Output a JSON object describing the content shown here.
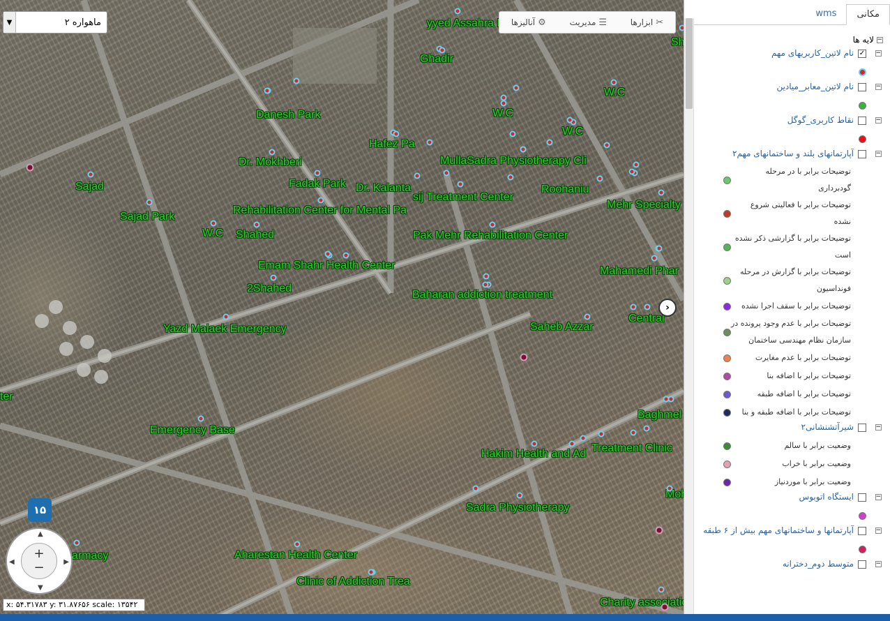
{
  "map": {
    "basemap_selector": {
      "value": "ماهواره ۲"
    },
    "toolbar": {
      "tools_label": "ابزارها",
      "manage_label": "مدیریت",
      "analysis_label": "آنالیزها"
    },
    "zoom_level": "۱۵",
    "zoom_in_label": "+",
    "zoom_out_label": "−",
    "coordinates": "x: ۵۴.۳۱۷۸۳ y: ۳۱.۸۷۶۵۶ scale: ۱۳۵۴۲",
    "collapse_label": "›",
    "poi_labels": [
      "yyed Assahra Pa",
      "Ghadir",
      "Danesh Park",
      "W.C",
      "W.C",
      "W.C",
      "Hafez Pa",
      "MullaSadra Physiotherapy Cli",
      "Dr. Mokhberi",
      "Fadak Park",
      "Dr. Kalanta",
      "Sajad",
      "sij Treatment Center",
      "Roohaniu",
      "Mehr Specialty",
      "Sajad Park",
      "Rehabilitation Center for Mental Pa",
      "W.C",
      "Shahed",
      "Pak Mehr Rehabilitation Center",
      "Emam Shahr Health Center",
      "Mahamedi Phar",
      "2Shahed",
      "Baharan addiction treatment",
      "Central",
      "Yazd Malaek Emergency",
      "Saheb Azzar",
      "ter",
      "Baghmel",
      "Emergency Base",
      "Treatment Clinic",
      "Hakim Health and Ad",
      "Sadra Physiotherapy",
      "Mohammad P",
      "h Pharmacy",
      "Aharestan Health Center",
      "Clinic of Addiction Trea",
      "Charity association for Protecti",
      "Shohadaa health c"
    ]
  },
  "panel": {
    "tabs": {
      "active": "مکانی",
      "inactive": "wms"
    },
    "tree_root": "لایه ها",
    "layers": [
      {
        "name": "نام لاتین_کاربریهای مهم",
        "checked": true,
        "legend": [
          {
            "text": "",
            "color": "#e0202a",
            "ring": "#5fd6f0"
          }
        ]
      },
      {
        "name": "نام لاتین_معابر_میادین",
        "checked": false,
        "legend": [
          {
            "text": "",
            "color": "#3bb23b"
          }
        ]
      },
      {
        "name": "نقاط کاربری_گوگل",
        "checked": false,
        "legend": [
          {
            "text": "",
            "color": "#e8101a"
          }
        ]
      },
      {
        "name": "آپارتمانهای بلند و ساختمانهای مهم۲",
        "checked": false,
        "legend": [
          {
            "text": "توضیحات برابر با در مرحله گودبرداری",
            "color": "#6cc66c"
          },
          {
            "text": "توضیحات برابر با فعالیتی شروع نشده",
            "color": "#c0392b"
          },
          {
            "text": "توضیحات برابر با گزارشی ذکر نشده است",
            "color": "#58b058"
          },
          {
            "text": "توضیحات برابر با گزارش در مرحله فونداسیون",
            "color": "#9ad28a"
          },
          {
            "text": "توضیحات برابر با سقف اجرا نشده",
            "color": "#8a2be2"
          },
          {
            "text": "توضیحات برابر با عدم وجود پرونده در سازمان نظام مهندسی ساختمان",
            "color": "#6a8f5a"
          },
          {
            "text": "توضیحات برابر با عدم مغایرت",
            "color": "#f08050"
          },
          {
            "text": "توضیحات برابر با اضافه بنا",
            "color": "#b04aa8"
          },
          {
            "text": "توضیحات برابر با اضافه طبقه",
            "color": "#6a5acd"
          },
          {
            "text": "توضیحات برابر با اضافه طبقه و بنا",
            "color": "#1e2a60"
          }
        ]
      },
      {
        "name": "شیرآتشنشانی۲",
        "checked": false,
        "legend": [
          {
            "text": "وضعیت برابر با سالم",
            "color": "#3a8a3a"
          },
          {
            "text": "وضعیت برابر با خراب",
            "color": "#e8a0b0"
          },
          {
            "text": "وضعیت برابر با موردنیاز",
            "color": "#6a2aa8"
          }
        ]
      },
      {
        "name": "ایستگاه اتوبوس",
        "checked": false,
        "legend": [
          {
            "text": "",
            "color": "#d040c8"
          }
        ]
      },
      {
        "name": "آپارتمانها و ساختمانهای مهم بیش از ۶ طبقه",
        "checked": false,
        "legend": [
          {
            "text": "",
            "color": "#d02060"
          }
        ]
      },
      {
        "name": "متوسط دوم_دخترانه",
        "checked": false,
        "legend": []
      }
    ]
  }
}
